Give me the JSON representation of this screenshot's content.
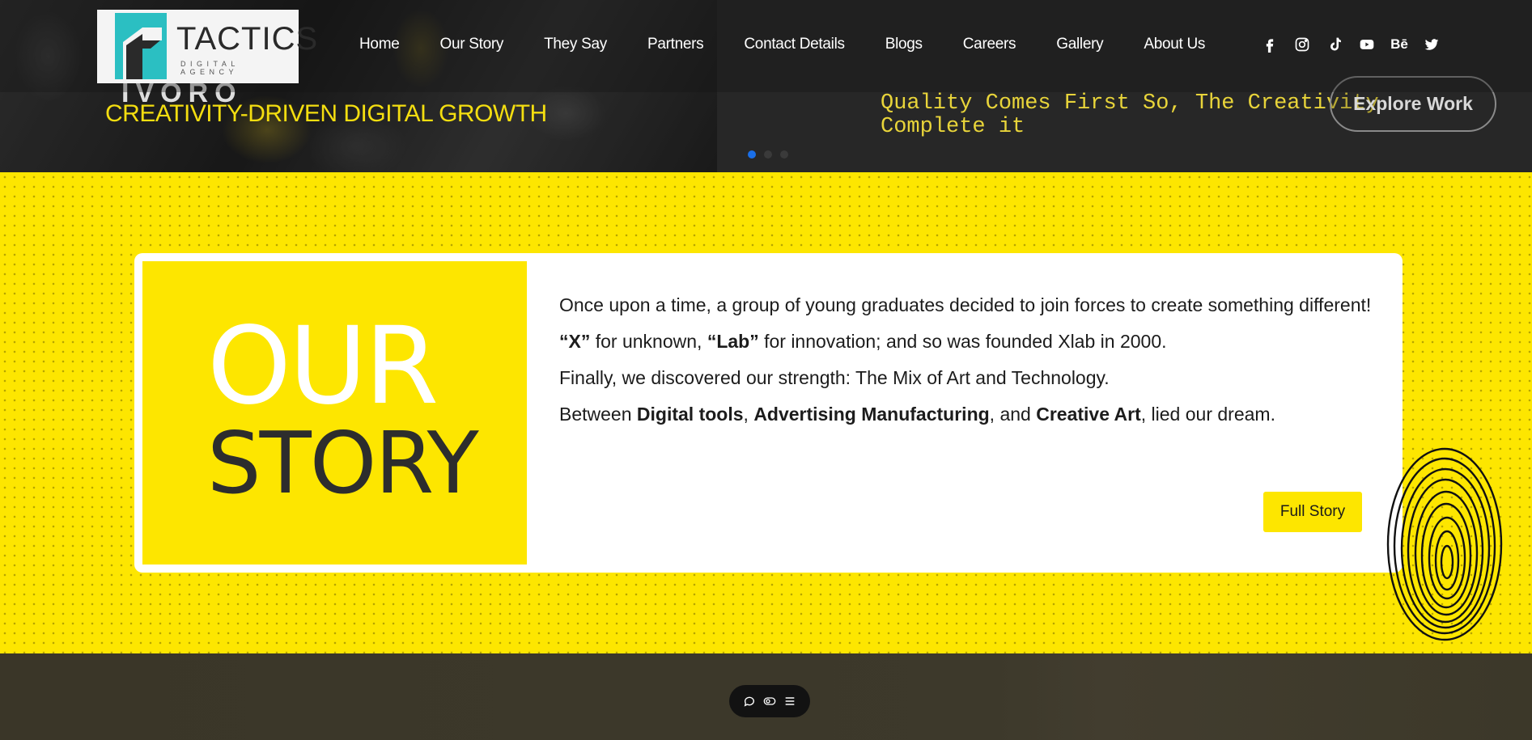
{
  "brand": {
    "name": "TACTICS",
    "tagline": "DIGITAL AGENCY",
    "colors": {
      "yellow": "#fde600",
      "teal": "#2bbfc2",
      "dark": "#2d2d2d"
    }
  },
  "nav": {
    "items": [
      {
        "label": "Home"
      },
      {
        "label": "Our Story"
      },
      {
        "label": "They Say"
      },
      {
        "label": "Partners"
      },
      {
        "label": "Contact Details"
      },
      {
        "label": "Blogs"
      },
      {
        "label": "Careers"
      },
      {
        "label": "Gallery"
      },
      {
        "label": "About Us"
      }
    ]
  },
  "socials": [
    "facebook-icon",
    "instagram-icon",
    "tiktok-icon",
    "youtube-icon",
    "behance-icon",
    "twitter-icon"
  ],
  "social_labels": {
    "behance": "Bē"
  },
  "hero": {
    "partial_heading": "IVORO",
    "subtitle": "CREATIVITY-DRIVEN DIGITAL GROWTH",
    "quote": "Quality Comes First So, The Creativity Complete it",
    "cta": "Explore Work",
    "slides_total": 3,
    "active_slide": 1
  },
  "story": {
    "heading_top": "OUR",
    "heading_bottom": "STORY",
    "paragraphs": {
      "p1": "Once upon a time, a group of young graduates decided to join forces to create something different!",
      "p2_a": "“X”",
      "p2_b": " for unknown, ",
      "p2_c": "“Lab”",
      "p2_d": " for innovation; and so was founded Xlab in 2000.",
      "p3": "Finally, we discovered our strength: The Mix of Art and Technology.",
      "p4_a": "Between ",
      "p4_b": "Digital tools",
      "p4_c": ", ",
      "p4_d": "Advertising Manufacturing",
      "p4_e": ", and ",
      "p4_f": "Creative Art",
      "p4_g": ", lied our dream."
    },
    "button": "Full Story"
  },
  "toolbar": {
    "icons": [
      "chat-icon",
      "toggle-icon",
      "menu-icon"
    ]
  }
}
